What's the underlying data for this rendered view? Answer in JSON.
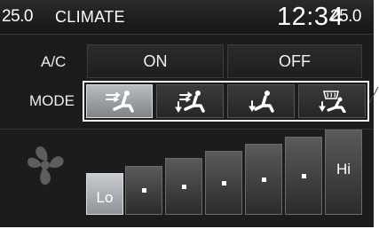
{
  "status_bar": {
    "left_temp": "25.0",
    "title": "CLIMATE",
    "clock": "12:34",
    "right_temp": "25.0"
  },
  "ac": {
    "label": "A/C",
    "on_label": "ON",
    "off_label": "OFF"
  },
  "mode": {
    "label": "MODE",
    "buttons": [
      {
        "icon": "vent-face-icon",
        "selected": true
      },
      {
        "icon": "vent-face-floor-icon",
        "selected": false
      },
      {
        "icon": "vent-floor-icon",
        "selected": false
      },
      {
        "icon": "floor-defrost-icon",
        "selected": false
      }
    ]
  },
  "fan_speed": {
    "icon": "fan-icon",
    "min_label": "Lo",
    "max_label": "Hi",
    "levels": 7,
    "current_level": 1
  },
  "colors": {
    "background": "#1c1c1c",
    "selected_fill": "#9ea2a7",
    "text": "#ffffff"
  }
}
